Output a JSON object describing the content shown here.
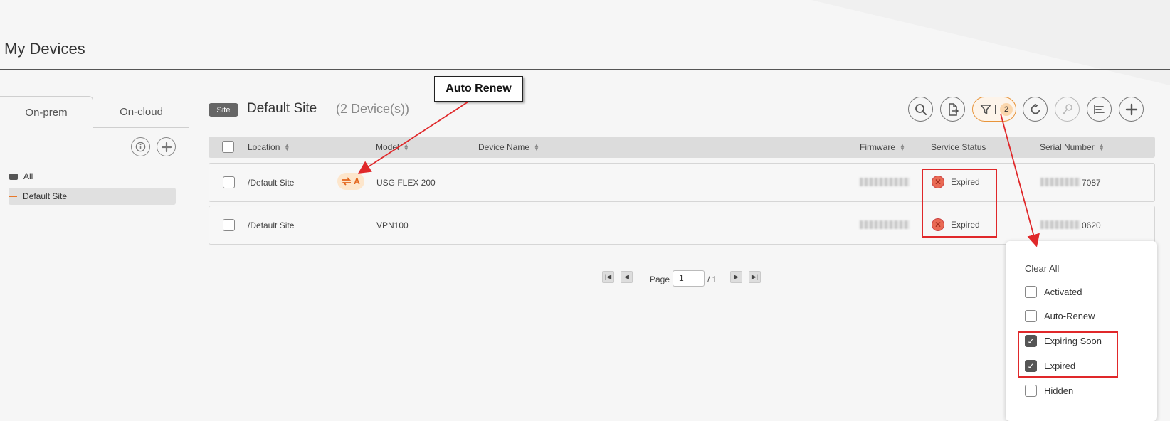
{
  "page": {
    "title": "My Devices"
  },
  "left": {
    "tabs": [
      {
        "label": "On-prem"
      },
      {
        "label": "On-cloud"
      }
    ],
    "tree": [
      {
        "label": "All"
      },
      {
        "label": "Default Site"
      }
    ]
  },
  "site": {
    "badge": "Site",
    "name": "Default Site",
    "count": "(2 Device(s))"
  },
  "toolbar": {
    "filter_count": "2"
  },
  "table": {
    "headers": {
      "location": "Location",
      "model": "Model",
      "device_name": "Device Name",
      "firmware": "Firmware",
      "service_status": "Service Status",
      "serial_number": "Serial Number"
    },
    "rows": [
      {
        "location": "/Default Site",
        "auto_label": "A",
        "model": "USG FLEX 200",
        "status": "Expired",
        "serial_suffix": "7087"
      },
      {
        "location": "/Default Site",
        "model": "VPN100",
        "status": "Expired",
        "serial_suffix": "0620"
      }
    ]
  },
  "pager": {
    "label": "Page",
    "value": "1",
    "total": "/ 1"
  },
  "callout": {
    "label": "Auto Renew"
  },
  "filter_menu": {
    "clear": "Clear All",
    "options": [
      {
        "label": "Activated",
        "checked": false
      },
      {
        "label": "Auto-Renew",
        "checked": false
      },
      {
        "label": "Expiring Soon",
        "checked": true
      },
      {
        "label": "Expired",
        "checked": true
      },
      {
        "label": "Hidden",
        "checked": false
      }
    ]
  },
  "colors": {
    "accent": "#e8782a",
    "highlight": "#e0282a",
    "expired": "#e96a54"
  }
}
